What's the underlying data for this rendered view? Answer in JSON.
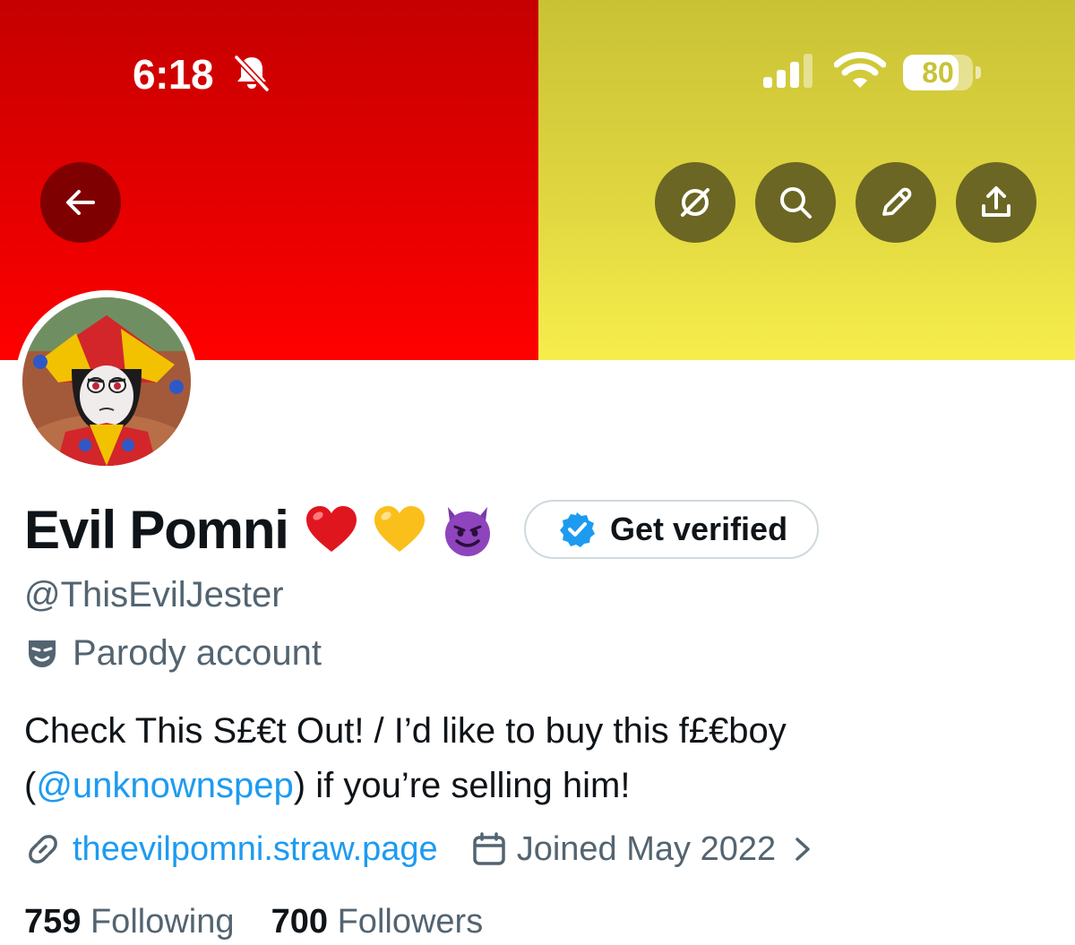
{
  "status_bar": {
    "time": "6:18",
    "battery_percent": "80",
    "battery_level": 0.8,
    "icons": [
      "bell-slash-icon",
      "signal-icon",
      "wifi-icon",
      "battery-icon"
    ]
  },
  "banner": {
    "left_color": "#e40000",
    "right_color": "#efe646"
  },
  "toolbar": {
    "back_icon": "arrow-left-icon",
    "actions": [
      "grok-icon",
      "search-icon",
      "edit-icon",
      "share-icon"
    ]
  },
  "profile": {
    "name": "Evil Pomni",
    "name_emojis": [
      "red-heart",
      "yellow-heart",
      "smiling-devil"
    ],
    "handle": "@ThisEvilJester",
    "label": "Parody account",
    "get_verified_label": "Get verified",
    "bio_text_1": "Check This S£€t Out! / I’d like to buy this f£€boy",
    "bio_open": "(",
    "bio_mention": "@unknownspep",
    "bio_text_2": ") if you’re selling him!",
    "website": "theevilpomni.straw.page",
    "joined": "Joined May 2022",
    "following_count": "759",
    "following_label": "Following",
    "followers_count": "700",
    "followers_label": "Followers"
  },
  "colors": {
    "accent": "#1d9bf0",
    "text_primary": "#0f1419",
    "text_secondary": "#536471",
    "button_olive": "#6b6623",
    "button_dark_red": "#7f0000"
  }
}
